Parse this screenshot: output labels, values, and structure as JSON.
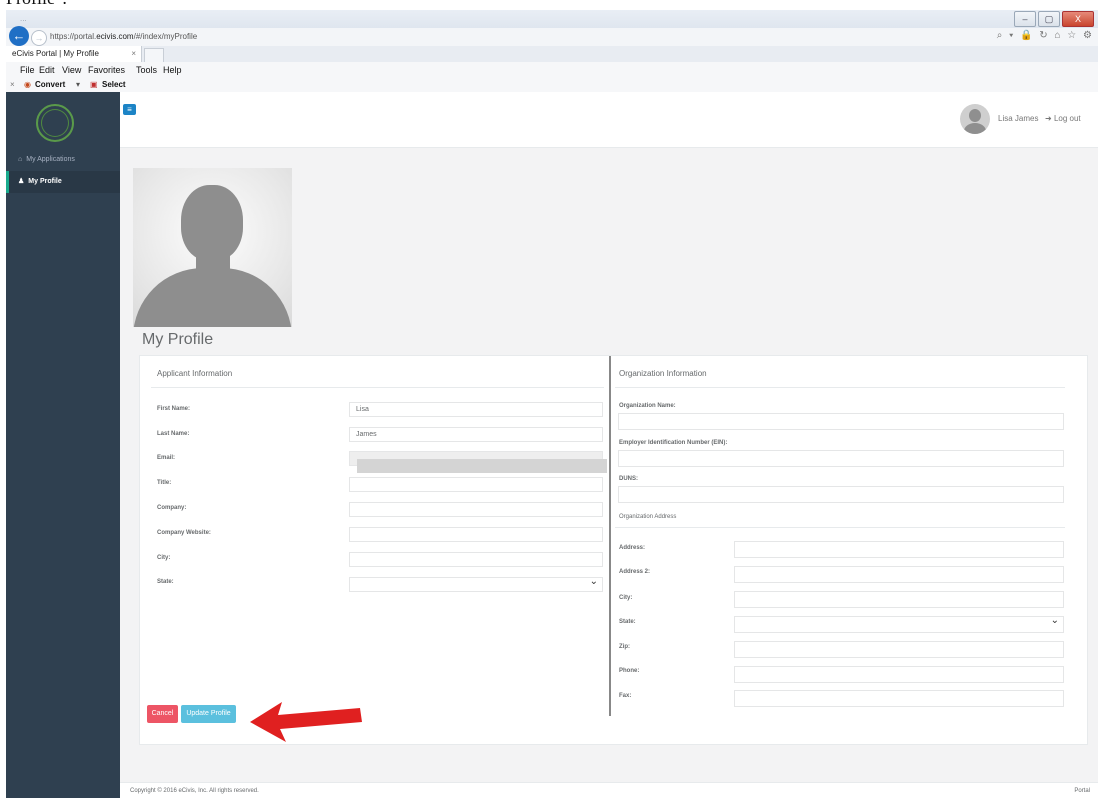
{
  "doc_fragment": "Profile\".",
  "browser": {
    "title_blur": "...",
    "url_prefix": "https://portal.",
    "url_domain": "ecivis.com",
    "url_path": "/#/index/myProfile",
    "tab_title": "eCivis Portal | My Profile",
    "tab_close": "×",
    "menu": [
      "File",
      "Edit",
      "View",
      "Favorites",
      "Tools",
      "Help"
    ],
    "command_convert": "Convert",
    "command_select": "Select",
    "command_close": "×",
    "window_buttons": [
      "–",
      "▢",
      "X"
    ],
    "right_icons": "⌕ ▾ 🔒 ↻  ⌂ ☆ ⚙"
  },
  "sidebar": {
    "items": [
      {
        "label": "My Applications",
        "icon": "home-icon",
        "active": false
      },
      {
        "label": "My Profile",
        "icon": "user-icon",
        "active": true
      }
    ]
  },
  "header": {
    "user_name": "Lisa James",
    "logout_label": "Log out"
  },
  "page": {
    "title": "My Profile"
  },
  "applicant": {
    "section_title": "Applicant Information",
    "fields": [
      {
        "label": "First Name:",
        "value": "Lisa"
      },
      {
        "label": "Last Name:",
        "value": "James"
      },
      {
        "label": "Email:",
        "value": ""
      },
      {
        "label": "Title:",
        "value": ""
      },
      {
        "label": "Company:",
        "value": ""
      },
      {
        "label": "Company Website:",
        "value": ""
      },
      {
        "label": "City:",
        "value": ""
      },
      {
        "label": "State:",
        "value": ""
      }
    ]
  },
  "organization": {
    "section_title": "Organization Information",
    "name_label": "Organization Name:",
    "ein_label": "Employer Identification Number (EIN):",
    "duns_label": "DUNS:",
    "address_heading": "Organization Address",
    "address_fields": [
      {
        "label": "Address:",
        "value": ""
      },
      {
        "label": "Address 2:",
        "value": ""
      },
      {
        "label": "City:",
        "value": ""
      },
      {
        "label": "State:",
        "value": ""
      },
      {
        "label": "Zip:",
        "value": ""
      },
      {
        "label": "Phone:",
        "value": ""
      },
      {
        "label": "Fax:",
        "value": ""
      }
    ]
  },
  "actions": {
    "cancel_label": "Cancel",
    "update_label": "Update Profile"
  },
  "footer": {
    "copyright": "Copyright © 2016 eCivis, Inc. All rights reserved.",
    "right_text": "Portal"
  },
  "colors": {
    "sidebar": "#2f4050",
    "cancel": "#ed5565",
    "update": "#5bc0de",
    "annotation_arrow": "#e02020"
  }
}
